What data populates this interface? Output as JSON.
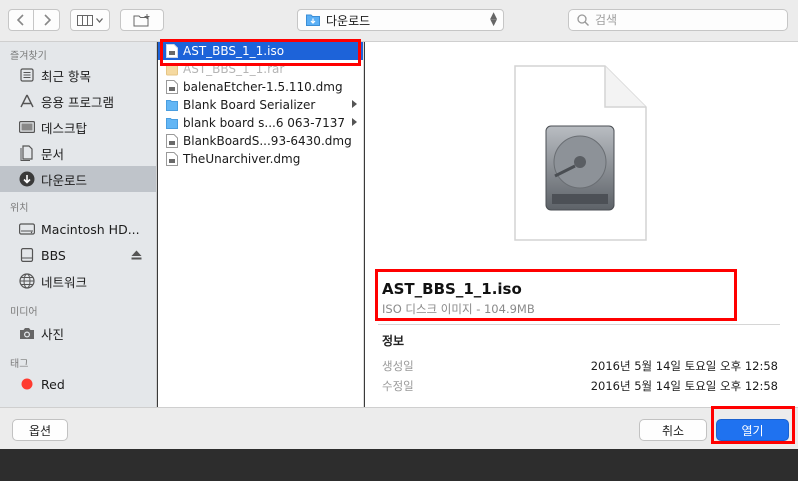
{
  "toolbar": {
    "location": "다운로드",
    "search_placeholder": "검색"
  },
  "sidebar": {
    "sections": {
      "favorites": "즐겨찾기",
      "locations": "위치",
      "media": "미디어",
      "tags": "태그"
    },
    "favorites": [
      {
        "label": "최근 항목",
        "icon": "recents-icon"
      },
      {
        "label": "응용 프로그램",
        "icon": "applications-icon"
      },
      {
        "label": "데스크탑",
        "icon": "desktop-icon"
      },
      {
        "label": "문서",
        "icon": "documents-icon"
      },
      {
        "label": "다운로드",
        "icon": "downloads-icon",
        "active": true
      }
    ],
    "locations": [
      {
        "label": "Macintosh HD...",
        "icon": "hard-disk-icon"
      },
      {
        "label": "BBS",
        "icon": "external-disk-icon"
      },
      {
        "label": "네트워크",
        "icon": "network-icon"
      }
    ],
    "media": [
      {
        "label": "사진",
        "icon": "camera-icon"
      }
    ],
    "tags": [
      {
        "label": "Red",
        "color": "#ff3b30"
      }
    ]
  },
  "files": [
    {
      "name": "AST_BBS_1_1.iso",
      "type": "file",
      "selected": true
    },
    {
      "name": "AST_BBS_1_1.rar",
      "type": "archive",
      "dim": true
    },
    {
      "name": "balenaEtcher-1.5.110.dmg",
      "type": "file"
    },
    {
      "name": "Blank Board Serializer",
      "type": "folder"
    },
    {
      "name": "blank board s...6 063-7137",
      "type": "folder"
    },
    {
      "name": "BlankBoardS...93-6430.dmg",
      "type": "file"
    },
    {
      "name": "TheUnarchiver.dmg",
      "type": "file"
    }
  ],
  "preview": {
    "name": "AST_BBS_1_1.iso",
    "kind": "ISO 디스크 이미지 - 104.9MB",
    "info_title": "정보",
    "created_label": "생성일",
    "created_value": "2016년 5월 14일 토요일 오후 12:58",
    "modified_label": "수정일",
    "modified_value": "2016년 5월 14일 토요일 오후 12:58"
  },
  "buttons": {
    "options": "옵션",
    "cancel": "취소",
    "open": "열기"
  },
  "colors": {
    "accent": "#1f72f0",
    "selection": "#1d63d9",
    "highlight": "#ff0000"
  }
}
